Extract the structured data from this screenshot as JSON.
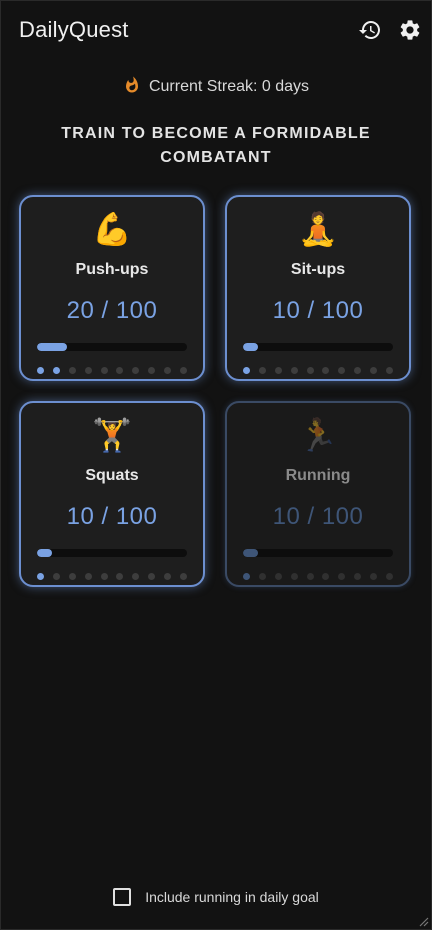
{
  "app": {
    "title": "DailyQuest"
  },
  "header": {
    "history_icon": "history-icon",
    "settings_icon": "gear-icon"
  },
  "streak": {
    "icon": "flame-icon",
    "text": "Current Streak: 0 days"
  },
  "motto": "TRAIN TO BECOME A FORMIDABLE COMBATANT",
  "exercises": [
    {
      "emoji": "💪",
      "icon": "flexed-biceps-icon",
      "name": "Push-ups",
      "count": "20 / 100",
      "current": 20,
      "goal": 100,
      "active_dots": 2,
      "enabled": true
    },
    {
      "emoji": "🧘",
      "icon": "meditation-icon",
      "name": "Sit-ups",
      "count": "10 / 100",
      "current": 10,
      "goal": 100,
      "active_dots": 1,
      "enabled": true
    },
    {
      "emoji": "🏋",
      "icon": "weightlifter-icon",
      "name": "Squats",
      "count": "10 / 100",
      "current": 10,
      "goal": 100,
      "active_dots": 1,
      "enabled": true
    },
    {
      "emoji": "🏃",
      "icon": "runner-icon",
      "name": "Running",
      "count": "10 / 100",
      "current": 10,
      "goal": 100,
      "active_dots": 1,
      "enabled": false
    }
  ],
  "dots_total": 10,
  "footer": {
    "checkbox_label": "Include running in daily goal",
    "checked": false
  },
  "colors": {
    "accent": "#7aa2e3",
    "card_border": "#6c8fd0",
    "background": "#121212",
    "streak_flame": "#e58b2a"
  }
}
